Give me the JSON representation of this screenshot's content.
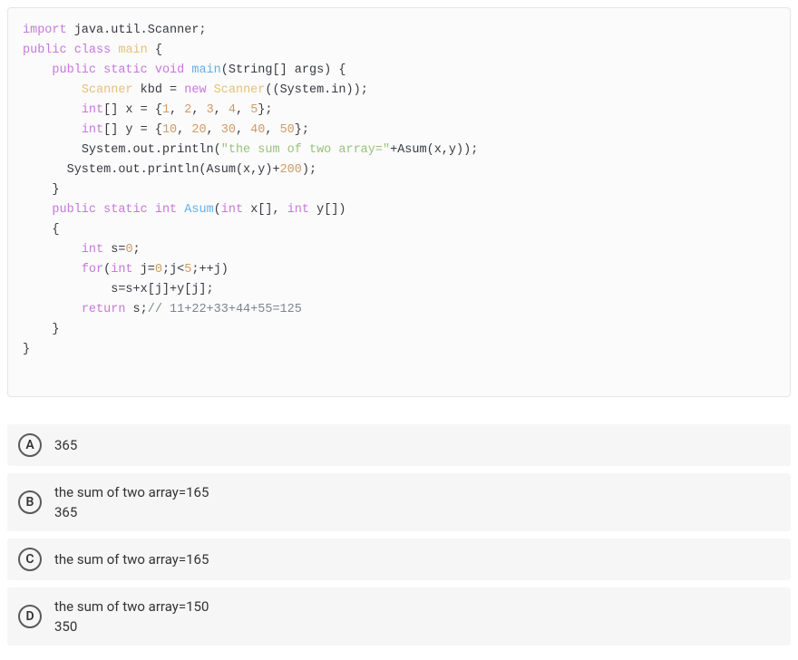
{
  "code": {
    "line1": {
      "kw_import": "import",
      "rest": " java.util.Scanner;"
    },
    "line2": {
      "kw_public": "public",
      "kw_class": "class",
      "cls": "main",
      "brace": " {"
    },
    "line3": {
      "kw_public": "public",
      "kw_static": "static",
      "kw_void": "void",
      "fn": "main",
      "params": "(String[] args) {"
    },
    "line4": {
      "type1": "Scanner",
      "var": " kbd = ",
      "kw_new": "new",
      "type2": " Scanner",
      "rest": "((System.in));"
    },
    "line5": {
      "type": "int",
      "rest1": "[] x = {",
      "n1": "1",
      "c": ", ",
      "n2": "2",
      "n3": "3",
      "n4": "4",
      "n5": "5",
      "end": "};"
    },
    "line6": {
      "type": "int",
      "rest1": "[] y = {",
      "n1": "10",
      "c": ", ",
      "n2": "20",
      "n3": "30",
      "n4": "40",
      "n5": "50",
      "end": "};"
    },
    "line7": {
      "pre": "System.out.println(",
      "str": "\"the sum of two array=\"",
      "post": "+Asum(x,y));"
    },
    "line8": {
      "pre": "System.out.println(Asum(x,y)+",
      "num": "200",
      "post": ");"
    },
    "line9": {
      "brace": "}"
    },
    "line10": {
      "kw_public": "public",
      "kw_static": "static",
      "kw_int": "int",
      "fn": "Asum",
      "params": "(",
      "t1": "int",
      "p1": " x[], ",
      "t2": "int",
      "p2": " y[])"
    },
    "line11": {
      "brace": "{"
    },
    "line12": {
      "type": "int",
      "rest": " s=",
      "num": "0",
      "semi": ";"
    },
    "line13": {
      "kw_for": "for",
      "open": "(",
      "type": "int",
      "rest1": " j=",
      "n0": "0",
      "mid": ";j<",
      "n5": "5",
      "end": ";++j)"
    },
    "line14": {
      "rest": "s=s+x[j]+y[j];"
    },
    "line15": {
      "kw_return": "return",
      "rest": " s;",
      "comment": "// 11+22+33+44+55=125"
    },
    "line16": {
      "brace": "}"
    },
    "line17": {
      "brace": "}"
    }
  },
  "options": {
    "a": {
      "letter": "A",
      "text": "365"
    },
    "b": {
      "letter": "B",
      "line1": "the sum of two array=165",
      "line2": "365"
    },
    "c": {
      "letter": "C",
      "text": "the sum of two array=165"
    },
    "d": {
      "letter": "D",
      "line1": "the sum of two array=150",
      "line2": "350"
    }
  }
}
